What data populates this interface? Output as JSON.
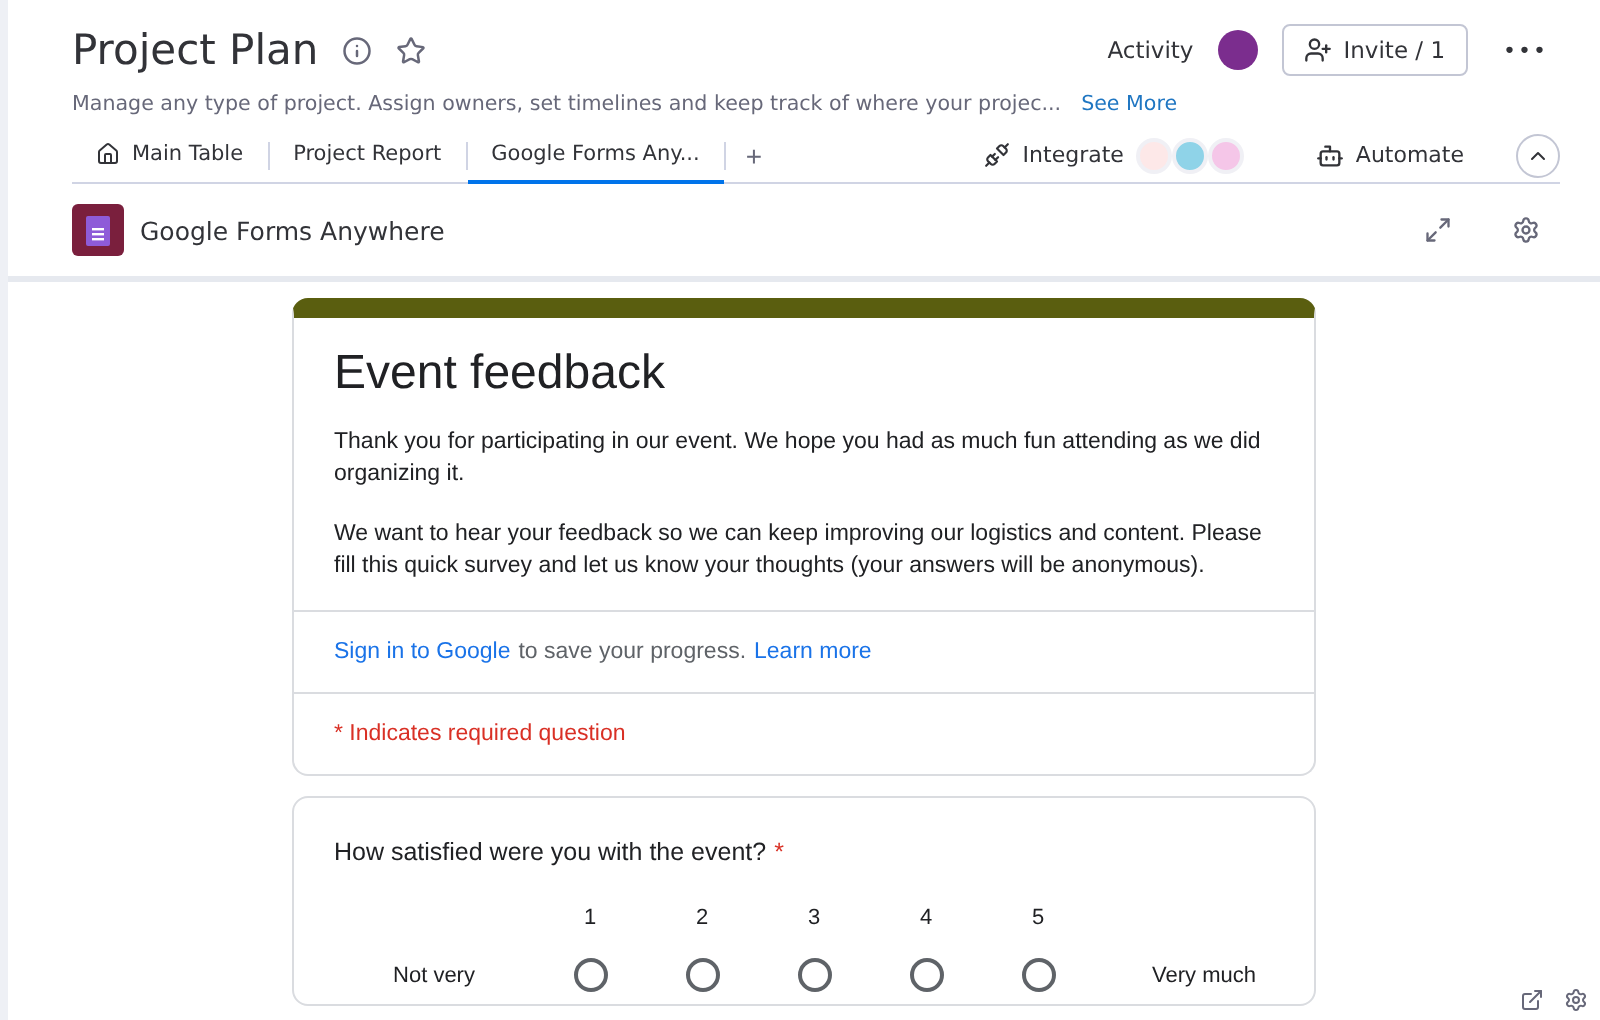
{
  "board": {
    "title": "Project Plan",
    "description": "Manage any type of project. Assign owners, set timelines and keep track of where your projec...",
    "see_more": "See More",
    "activity": "Activity",
    "invite": "Invite / 1",
    "more": "•••"
  },
  "tabs": [
    {
      "label": "Main Table",
      "kind": "home",
      "selected": false
    },
    {
      "label": "Project Report",
      "kind": "plain",
      "selected": false
    },
    {
      "label": "Google Forms Any...",
      "kind": "plain",
      "selected": true
    }
  ],
  "add_tab": "+",
  "integrate": "Integrate",
  "automate": "Automate",
  "app_bar": {
    "title": "Google Forms Anywhere"
  },
  "form": {
    "title": "Event feedback",
    "paragraphs": [
      "Thank you for participating in our event. We hope you had as much fun attending as we did organizing it.",
      "We want to hear your feedback so we can keep improving our logistics and content. Please fill this quick survey and let us know your thoughts (your answers will be anonymous)."
    ],
    "sign_in": "Sign in to Google",
    "sign_in_rest": "to save your progress.",
    "learn_more": "Learn more",
    "required_note": "* Indicates required question"
  },
  "question": {
    "text": "How satisfied were you with the event?",
    "required_mark": "*",
    "low_label": "Not very",
    "high_label": "Very much",
    "options": [
      {
        "label": "1",
        "selected": false
      },
      {
        "label": "2",
        "selected": false
      },
      {
        "label": "3",
        "selected": false
      },
      {
        "label": "4",
        "selected": false
      },
      {
        "label": "5",
        "selected": false
      }
    ]
  }
}
